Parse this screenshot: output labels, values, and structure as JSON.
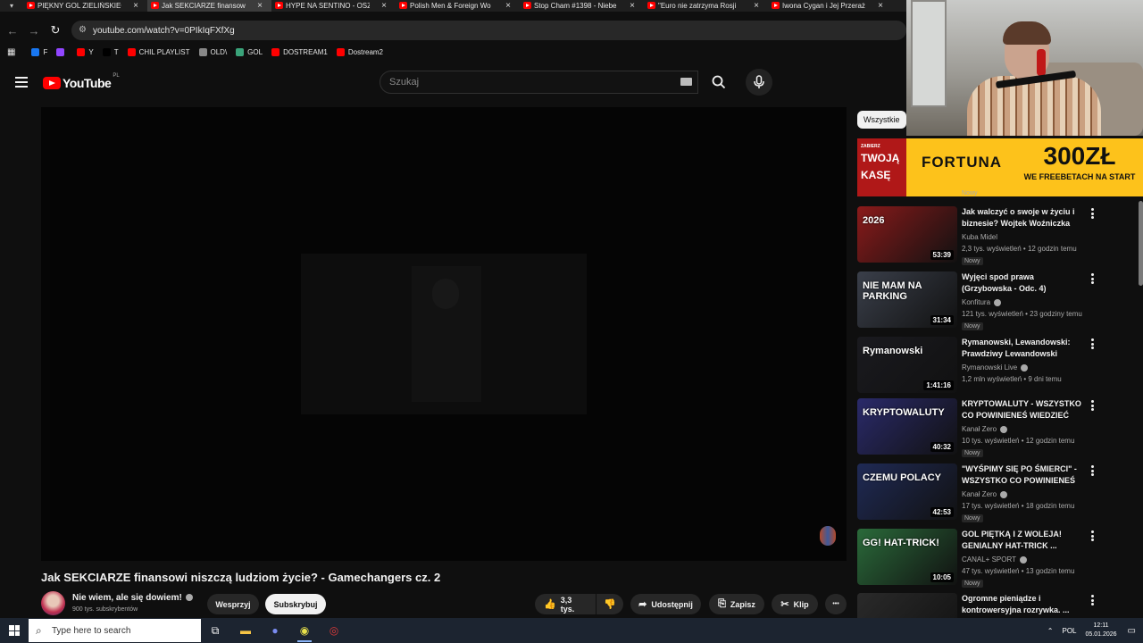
{
  "browser": {
    "tabs": [
      {
        "title": "PIĘKNY GOL ZIELIŃSKIEGO",
        "active": false
      },
      {
        "title": "Jak SEKCIARZE finansowi",
        "active": true
      },
      {
        "title": "HYPE NA SENTINO - OSZ",
        "active": false
      },
      {
        "title": "Polish Men & Foreign Wo",
        "active": false
      },
      {
        "title": "Stop Cham #1398 - Niebe",
        "active": false
      },
      {
        "title": "\"Euro nie zatrzyma Rosji",
        "active": false
      },
      {
        "title": "Iwona Cygan i Jej Przeraż",
        "active": false
      }
    ],
    "close_glyph": "×",
    "url": "youtube.com/watch?v=0PIkIqFXfXg",
    "bookmarks": [
      {
        "label": "F",
        "color": "#1877f2"
      },
      {
        "label": "",
        "color": "#9146ff"
      },
      {
        "label": "Y",
        "color": "#ff0000"
      },
      {
        "label": "T",
        "color": "#000000"
      },
      {
        "label": "CHIL PLAYLIST",
        "color": "#ff0000"
      },
      {
        "label": "OLD\\",
        "color": "#888888"
      },
      {
        "label": "GOL",
        "color": "#3aa37a"
      },
      {
        "label": "DOSTREAM1",
        "color": "#ff0000"
      },
      {
        "label": "Dostream2",
        "color": "#ff0000"
      }
    ]
  },
  "header": {
    "logo_text": "YouTube",
    "country_code": "PL",
    "search_placeholder": "Szukaj"
  },
  "video": {
    "title": "Jak SEKCIARZE finansowi niszczą ludziom życie? - Gamechangers cz. 2",
    "channel_name": "Nie wiem, ale się dowiem!",
    "subscribers": "900 tys. subskrybentów",
    "support_label": "Wesprzyj",
    "subscribe_label": "Subskrybuj",
    "likes": "3,3 tys.",
    "share_label": "Udostępnij",
    "save_label": "Zapisz",
    "clip_label": "Klip",
    "more_glyph": "•••"
  },
  "sidebar": {
    "chip_label": "Wszystkie",
    "ad": {
      "left_top": "ZABIERZ",
      "left_text_1": "TWOJĄ",
      "left_text_2": "KASĘ",
      "brand": "FORTUNA",
      "amount": "300ZŁ",
      "tagline": "WE FREEBETACH NA START",
      "new_badge": "Nowy"
    },
    "recommendations": [
      {
        "title": "Jak walczyć o swoje w życiu i biznesie? Wojtek Woźniczka",
        "channel": "Kuba Midel",
        "verified": false,
        "meta": "2,3 tys. wyświetleń • 12 godzin temu",
        "duration": "53:39",
        "new": "Nowy",
        "overlay": "2026",
        "color": "#8a1a1a"
      },
      {
        "title": "Wyjęci spod prawa (Grzybowska - Odc. 4)",
        "channel": "Konfitura",
        "verified": true,
        "meta": "121 tys. wyświetleń • 23 godziny temu",
        "duration": "31:34",
        "new": "Nowy",
        "overlay": "NIE MAM NA PARKING",
        "color": "#3a3f4a"
      },
      {
        "title": "Rymanowski, Lewandowski: Prawdziwy Lewandowski",
        "channel": "Rymanowski Live",
        "verified": true,
        "meta": "1,2 mln wyświetleń • 9 dni temu",
        "duration": "1:41:16",
        "new": "",
        "overlay": "Rymanowski",
        "color": "#1a1a1f"
      },
      {
        "title": "KRYPTOWALUTY - WSZYSTKO CO POWINIENEŚ WIEDZIEĆ",
        "channel": "Kanał Zero",
        "verified": true,
        "meta": "10 tys. wyświetleń • 12 godzin temu",
        "duration": "40:32",
        "new": "Nowy",
        "overlay": "KRYPTOWALUTY",
        "color": "#2a2a6a"
      },
      {
        "title": "\"WYŚPIMY SIĘ PO ŚMIERCI\" - WSZYSTKO CO POWINIENEŚ ...",
        "channel": "Kanał Zero",
        "verified": true,
        "meta": "17 tys. wyświetleń • 18 godzin temu",
        "duration": "42:53",
        "new": "Nowy",
        "overlay": "CZEMU POLACY",
        "color": "#1f2a55"
      },
      {
        "title": "GOL PIĘTKĄ I Z WOLEJA! GENIALNY HAT-TRICK ...",
        "channel": "CANAL+ SPORT",
        "verified": true,
        "meta": "47 tys. wyświetleń • 13 godzin temu",
        "duration": "10:05",
        "new": "Nowy",
        "overlay": "GG! HAT-TRICK!",
        "color": "#2a6a3a"
      },
      {
        "title": "Ogromne pieniądze i kontrowersyjna rozrywka. ...",
        "channel": "",
        "verified": false,
        "meta": "",
        "duration": "",
        "new": "",
        "overlay": "",
        "color": "#2a2a2a"
      }
    ]
  },
  "taskbar": {
    "search_placeholder": "Type here to search",
    "language": "POL",
    "time": "12:11",
    "date": "05.01.2026"
  }
}
